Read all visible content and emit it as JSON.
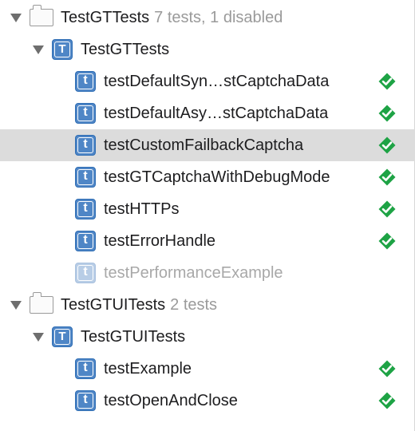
{
  "bundles": [
    {
      "name": "TestGTTests",
      "meta": "7 tests, 1 disabled",
      "class": {
        "icon_letter": "T",
        "name": "TestGTTests",
        "tests": [
          {
            "name": "testDefaultSyn…stCaptchaData",
            "status": "passed"
          },
          {
            "name": "testDefaultAsy…stCaptchaData",
            "status": "passed"
          },
          {
            "name": "testCustomFailbackCaptcha",
            "status": "passed",
            "selected": true
          },
          {
            "name": "testGTCaptchaWithDebugMode",
            "status": "passed"
          },
          {
            "name": "testHTTPs",
            "status": "passed"
          },
          {
            "name": "testErrorHandle",
            "status": "passed"
          },
          {
            "name": "testPerformanceExample",
            "status": "disabled"
          }
        ]
      }
    },
    {
      "name": "TestGTUITests",
      "meta": "2 tests",
      "class": {
        "icon_letter": "T",
        "name": "TestGTUITests",
        "tests": [
          {
            "name": "testExample",
            "status": "passed"
          },
          {
            "name": "testOpenAndClose",
            "status": "passed"
          }
        ]
      }
    }
  ],
  "test_icon_letter": "t",
  "icons": {
    "disclosure": "disclosure-triangle-icon",
    "bundle": "test-bundle-icon",
    "class": "test-class-icon",
    "test": "test-method-icon",
    "passed": "passed-checkmark-icon"
  },
  "colors": {
    "passed": "#1ea345",
    "icon_blue": "#4f86c6",
    "selection": "#dcdcdc",
    "meta_text": "#9a9a9a",
    "disabled_text": "#a8a8a8"
  }
}
